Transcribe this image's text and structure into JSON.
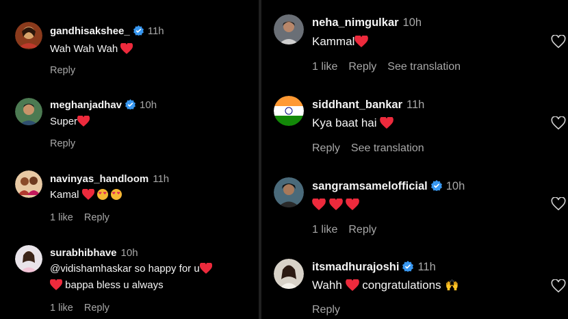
{
  "colors": {
    "background": "#000000",
    "text": "#f5f5f5",
    "muted": "#a8a8a8",
    "heart": "#ed2a3c",
    "verified": "#3897f0"
  },
  "left_comments": [
    {
      "username": "gandhisakshee_",
      "verified": true,
      "time": "11h",
      "text": "Wah Wah Wah",
      "actions": [
        "Reply"
      ]
    },
    {
      "username": "meghanjadhav",
      "verified": true,
      "time": "10h",
      "text": "Super",
      "actions": [
        "Reply"
      ]
    },
    {
      "username": "navinyas_handloom",
      "verified": false,
      "time": "11h",
      "text": "Kamal",
      "actions": [
        "1 like",
        "Reply"
      ]
    },
    {
      "username": "surabhibhave",
      "verified": false,
      "time": "10h",
      "text": "@vidishamhaskar so happy for u",
      "text2": "bappa bless u always",
      "actions": [
        "1 like",
        "Reply"
      ]
    }
  ],
  "right_comments": [
    {
      "username": "neha_nimgulkar",
      "verified": false,
      "time": "10h",
      "text": "Kammal",
      "actions": [
        "1 like",
        "Reply",
        "See translation"
      ]
    },
    {
      "username": "siddhant_bankar",
      "verified": false,
      "time": "11h",
      "text": "Kya baat hai",
      "actions": [
        "Reply",
        "See translation"
      ]
    },
    {
      "username": "sangramsamelofficial",
      "verified": true,
      "time": "10h",
      "text": "",
      "actions": [
        "1 like",
        "Reply"
      ]
    },
    {
      "username": "itsmadhurajoshi",
      "verified": true,
      "time": "11h",
      "text": "Wahh",
      "text_after": "congratulations",
      "actions": [
        "Reply"
      ]
    }
  ],
  "icons": {
    "heart": "heart-icon",
    "like": "heart-outline-icon",
    "verified": "verified-badge-icon"
  }
}
